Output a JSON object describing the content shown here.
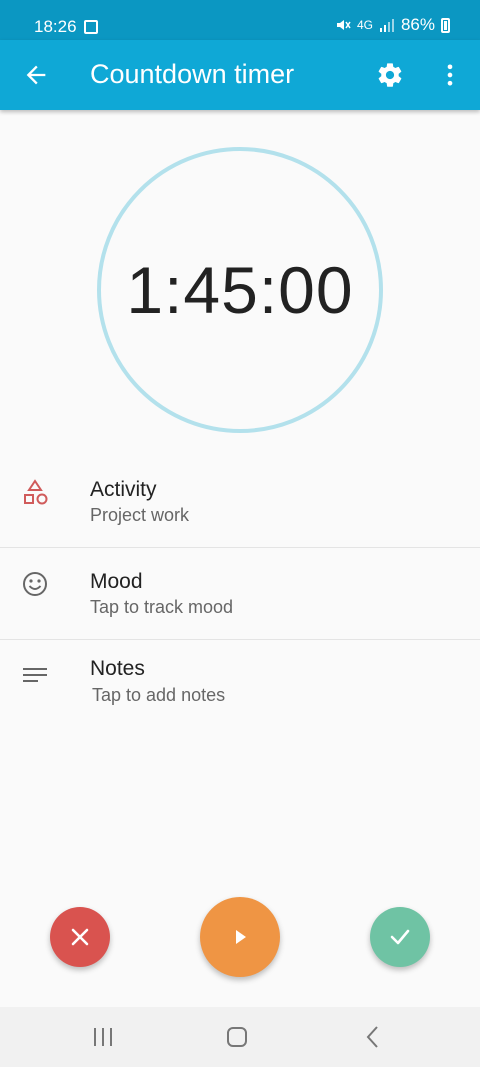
{
  "status_bar": {
    "time": "18:26",
    "network_label": "4G",
    "battery": "86%"
  },
  "app_bar": {
    "title": "Countdown timer",
    "icons": [
      "back-arrow-icon",
      "gear-icon",
      "more-vert-icon"
    ]
  },
  "timer": {
    "value": "1:45:00",
    "ring_color": "#b3e1ec"
  },
  "details": [
    {
      "label": "Activity",
      "value": "Project work",
      "icon": "shapes-icon",
      "icon_color": "#d05b5b"
    },
    {
      "label": "Mood",
      "value": "Tap to track mood",
      "icon": "smiley-icon"
    },
    {
      "label": "Notes",
      "value": "Tap to add notes",
      "icon": "notes-icon"
    }
  ],
  "actions": {
    "cancel": {
      "icon": "close-icon",
      "color": "#d9534f"
    },
    "start": {
      "icon": "play-icon",
      "color": "#ef9544"
    },
    "finish": {
      "icon": "check-icon",
      "color": "#6fc3a4"
    }
  },
  "theme": {
    "app_bar_color": "#0fa8d6",
    "status_bar_color": "#0b97c2"
  }
}
